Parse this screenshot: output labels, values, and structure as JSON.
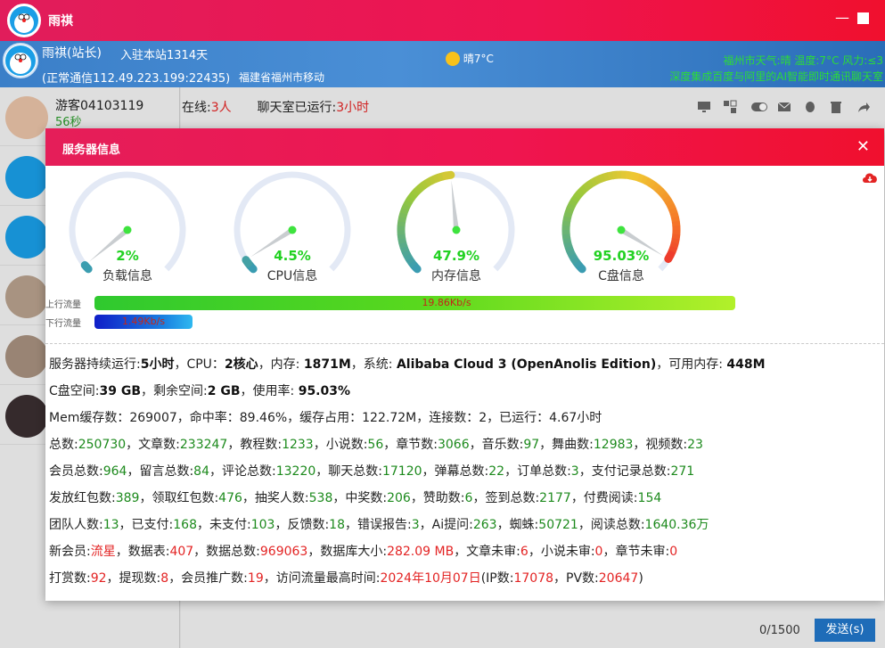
{
  "app": {
    "title": "雨祺"
  },
  "header": {
    "user_name": "雨祺(站长)",
    "joined": "入驻本站1314天",
    "connection": "(正常通信112.49.223.199:22435)",
    "location": "福建省福州市移动",
    "weather": "晴7°C",
    "notice_line1": "福州市天气:晴 温度:7°C 风力:≤3",
    "notice_line2": "深度集成百度与阿里的AI智能即时通讯聊天室"
  },
  "left_panel": {
    "items": [
      {
        "name": "游客04103119",
        "sub": "56秒"
      }
    ]
  },
  "status": {
    "online_label": "在线:",
    "online_count": "3人",
    "runtime_label": "聊天室已运行:",
    "runtime_value": "3小时"
  },
  "dialog": {
    "title": "服务器信息",
    "gauges": [
      {
        "value_text": "2%",
        "label": "负载信息",
        "value": 2
      },
      {
        "value_text": "4.5%",
        "label": "CPU信息",
        "value": 4.5
      },
      {
        "value_text": "47.9%",
        "label": "内存信息",
        "value": 47.9
      },
      {
        "value_text": "95.03%",
        "label": "C盘信息",
        "value": 95.03
      }
    ],
    "upload": {
      "label": "上行流量",
      "value_text": "19.86Kb/s",
      "fill": 0.91
    },
    "download": {
      "label": "下行流量",
      "value_text": "1.49Kb/s",
      "fill": 0.11
    },
    "info": {
      "l1": [
        "服务器持续运行:",
        "5小时",
        "，CPU：",
        "2核心",
        "，内存: ",
        "1871M",
        "，系统: ",
        "Alibaba Cloud 3 (OpenAnolis Edition)",
        "，可用内存: ",
        "448M"
      ],
      "l2": [
        "C盘空间:",
        "39 GB",
        "，剩余空间:",
        "2 GB",
        "，使用率: ",
        "95.03%"
      ],
      "l3": "Mem缓存数：269007，命中率：89.46%，缓存占用：122.72M，连接数：2，已运行：4.67小时",
      "l4": [
        "总数:",
        "250730",
        "，文章数:",
        "233247",
        "，教程数:",
        "1233",
        "，小说数:",
        "56",
        "，章节数:",
        "3066",
        "，音乐数:",
        "97",
        "，舞曲数:",
        "12983",
        "，视频数:",
        "23"
      ],
      "l5": [
        "会员总数:",
        "964",
        "，留言总数:",
        "84",
        "，评论总数:",
        "13220",
        "，聊天总数:",
        "17120",
        "，弹幕总数:",
        "22",
        "，订单总数:",
        "3",
        "，支付记录总数:",
        "271"
      ],
      "l6": [
        "发放红包数:",
        "389",
        "，领取红包数:",
        "476",
        "，抽奖人数:",
        "538",
        "，中奖数:",
        "206",
        "，赞助数:",
        "6",
        "，签到总数:",
        "2177",
        "，付费阅读:",
        "154"
      ],
      "l7": [
        "团队人数:",
        "13",
        "，已支付:",
        "168",
        "，未支付:",
        "103",
        "，反馈数:",
        "18",
        "，错误报告:",
        "3",
        "，Ai提问:",
        "263",
        "，蜘蛛:",
        "50721",
        "，阅读总数:",
        "1640.36万"
      ],
      "l8": [
        "新会员:",
        "流星",
        "，数据表:",
        "407",
        "，数据总数:",
        "969063",
        "，数据库大小:",
        "282.09 MB",
        "，文章未审:",
        "6",
        "，小说未审:",
        "0",
        "，章节未审:",
        "0"
      ],
      "l9": [
        "打赏数:",
        "92",
        "，提现数:",
        "8",
        "，会员推广数:",
        "19",
        "，访问流量最高时间:",
        "2024年10月07日",
        "(IP数:",
        "17078",
        "，PV数:",
        "20647",
        ")"
      ]
    }
  },
  "footer": {
    "char_count": "0/1500",
    "send_label": "发送(s)"
  },
  "colors": {
    "accent": "#ee1450",
    "header_blue": "#3b7fc8",
    "value_green": "#22d122",
    "info_green": "#1d8a1d",
    "info_red": "#e32424"
  },
  "icons": [
    "monitor-icon",
    "qr-icon",
    "toggle-icon",
    "mail-icon",
    "qq-icon",
    "trash-icon",
    "share-icon",
    "cloud-download-icon",
    "close-icon"
  ]
}
